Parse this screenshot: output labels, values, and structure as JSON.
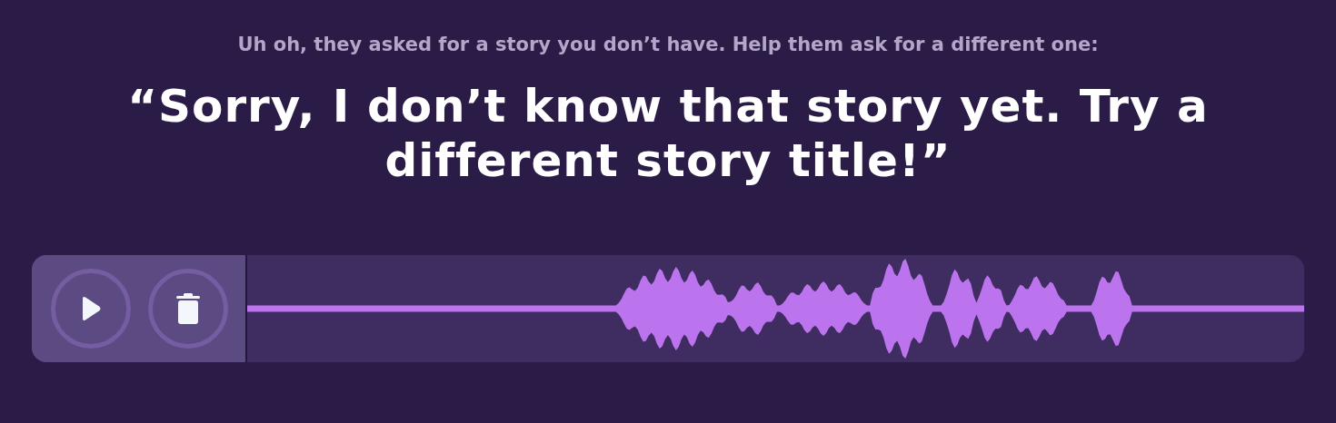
{
  "prompt": "Uh oh, they asked for a story you don’t have. Help them ask for a different one:",
  "quote": "“Sorry, I don’t know that story yet. Try a different story title!”",
  "player": {
    "buttons": [
      {
        "kind": "play"
      },
      {
        "kind": "delete"
      }
    ]
  }
}
